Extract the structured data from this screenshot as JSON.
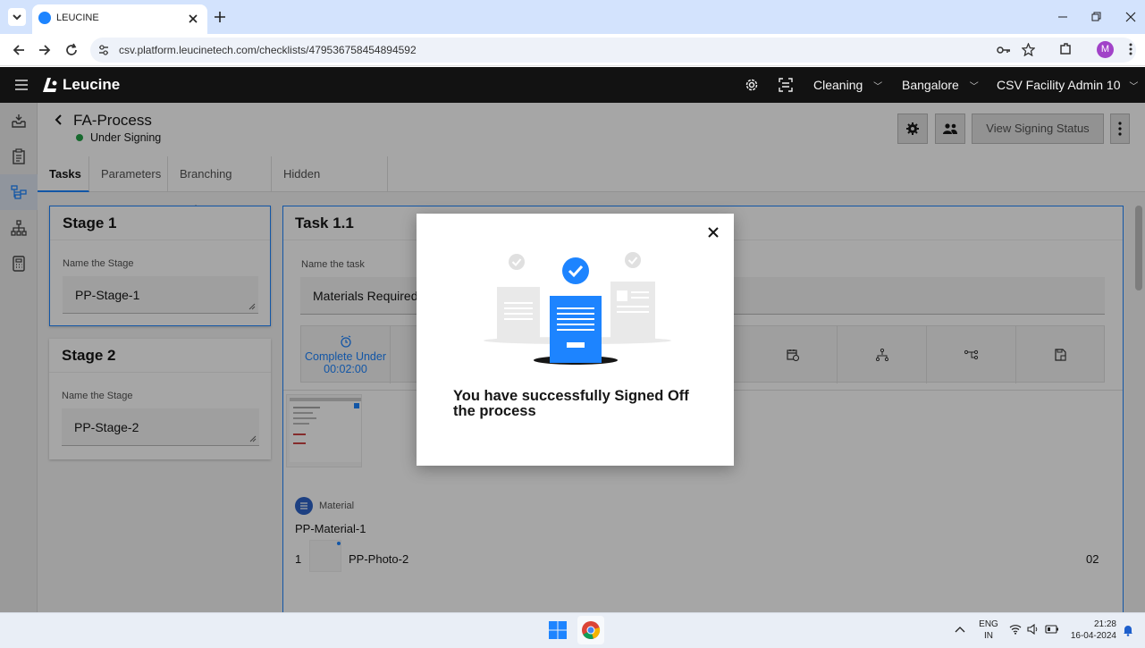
{
  "browser": {
    "tab_title": "LEUCINE",
    "url": "csv.platform.leucinetech.com/checklists/479536758454894592",
    "profile_initial": "M"
  },
  "app": {
    "logo_text": "Leucine",
    "header_dropdowns": [
      "Cleaning",
      "Bangalore",
      "CSV Facility Admin 10"
    ]
  },
  "page": {
    "title": "FA-Process",
    "status": "Under Signing",
    "view_signing_label": "View Signing Status",
    "tabs": [
      "Tasks",
      "Parameters",
      "Branching Rules",
      "Hidden Parameters"
    ]
  },
  "stages": [
    {
      "title": "Stage 1",
      "field_label": "Name the Stage",
      "value": "PP-Stage-1"
    },
    {
      "title": "Stage 2",
      "field_label": "Name the Stage",
      "value": "PP-Stage-2"
    }
  ],
  "task": {
    "title": "Task 1.1",
    "field_label": "Name the task",
    "value": "Materials Required",
    "timer_label": "Complete Under",
    "timer_value": "00:02:00",
    "material_heading": "Material",
    "material_name": "PP-Material-1",
    "item_index": "1",
    "item_name": "PP-Photo-2",
    "item_qty": "02"
  },
  "modal": {
    "message": "You have successfully Signed Off the process"
  },
  "taskbar": {
    "lang_top": "ENG",
    "lang_bottom": "IN",
    "time": "21:28",
    "date": "16-04-2024"
  },
  "colors": {
    "accent": "#1d84ff",
    "status_green": "#24a148",
    "header_bg": "#121212"
  }
}
